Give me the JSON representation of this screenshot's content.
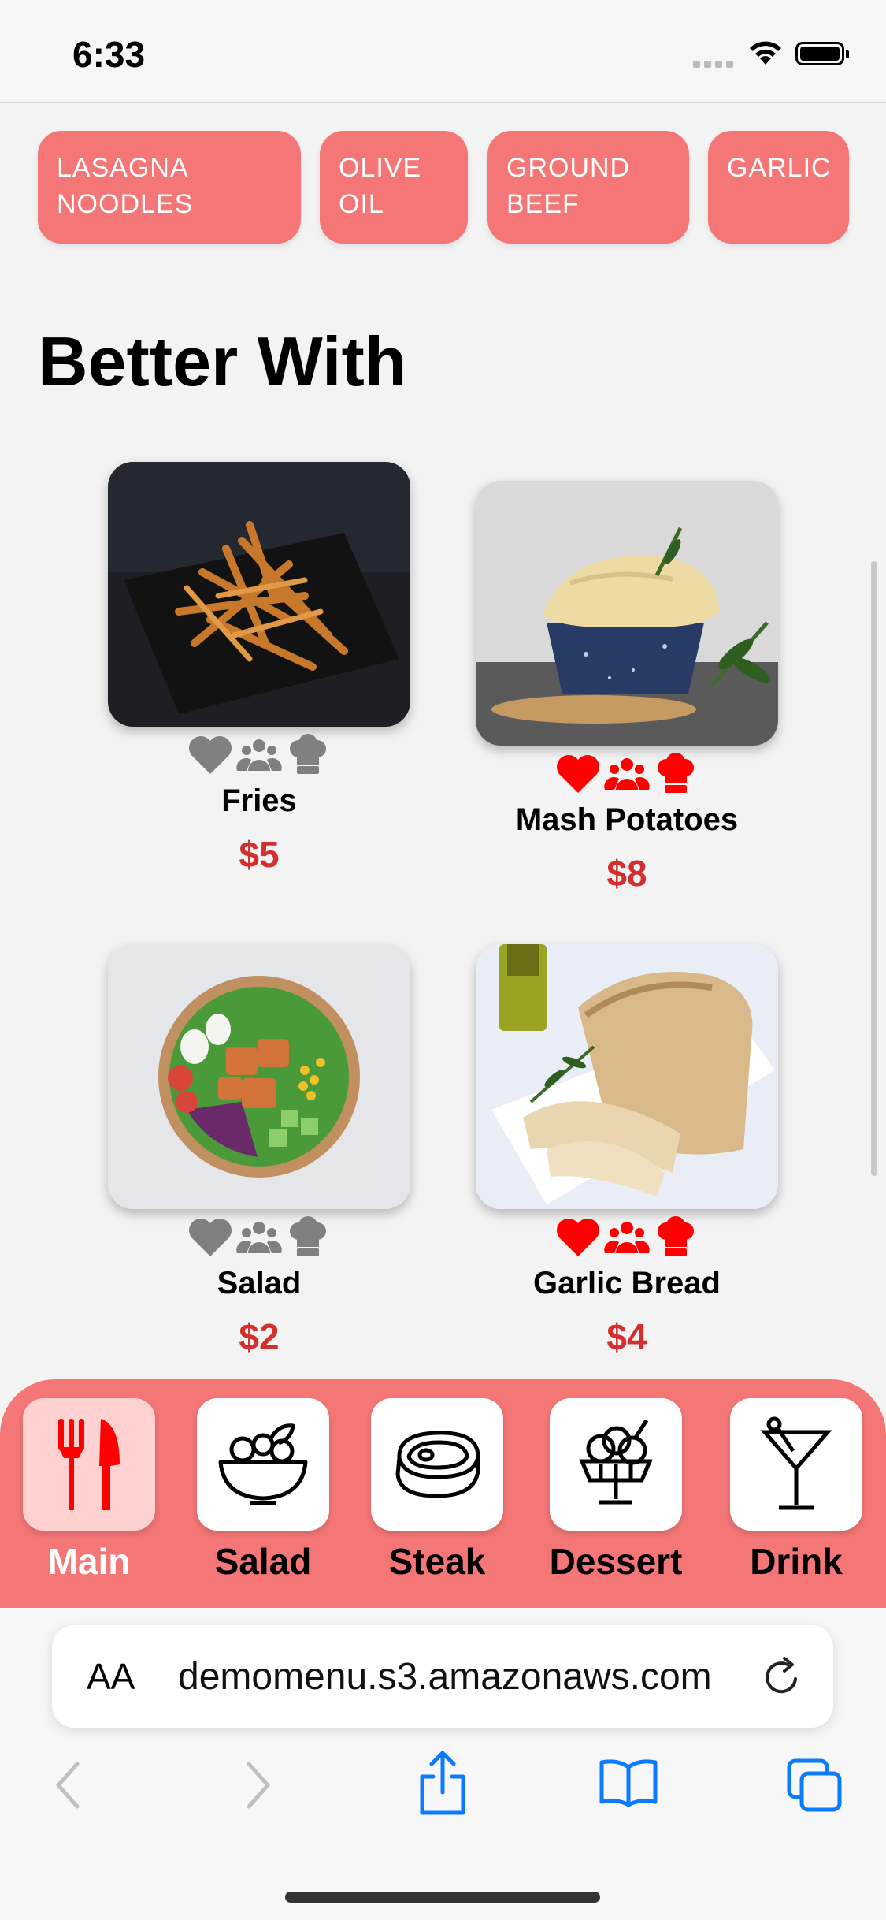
{
  "status": {
    "time": "6:33"
  },
  "ingredients": [
    "LASAGNA NOODLES",
    "OLIVE OIL",
    "GROUND BEEF",
    "GARLIC"
  ],
  "section_title": "Better With",
  "items": [
    {
      "name": "Fries",
      "price": "$5",
      "favorited": false
    },
    {
      "name": "Mash Potatoes",
      "price": "$8",
      "favorited": true
    },
    {
      "name": "Salad",
      "price": "$2",
      "favorited": false
    },
    {
      "name": "Garlic Bread",
      "price": "$4",
      "favorited": true
    }
  ],
  "item_icons": [
    "heart-icon",
    "group-icon",
    "chef-hat-icon"
  ],
  "categories": [
    {
      "label": "Main",
      "icon": "fork-knife-icon",
      "active": true
    },
    {
      "label": "Salad",
      "icon": "salad-bowl-icon",
      "active": false
    },
    {
      "label": "Steak",
      "icon": "steak-icon",
      "active": false
    },
    {
      "label": "Dessert",
      "icon": "ice-cream-icon",
      "active": false
    },
    {
      "label": "Drink",
      "icon": "cocktail-icon",
      "active": false
    }
  ],
  "browser": {
    "text_size_label": "AA",
    "url": "demomenu.s3.amazonaws.com"
  },
  "colors": {
    "accent": "#f47676",
    "price": "#d32f2f",
    "active_icon": "#ff0000",
    "inactive_icon": "#808080",
    "link_blue": "#0a7aff"
  }
}
